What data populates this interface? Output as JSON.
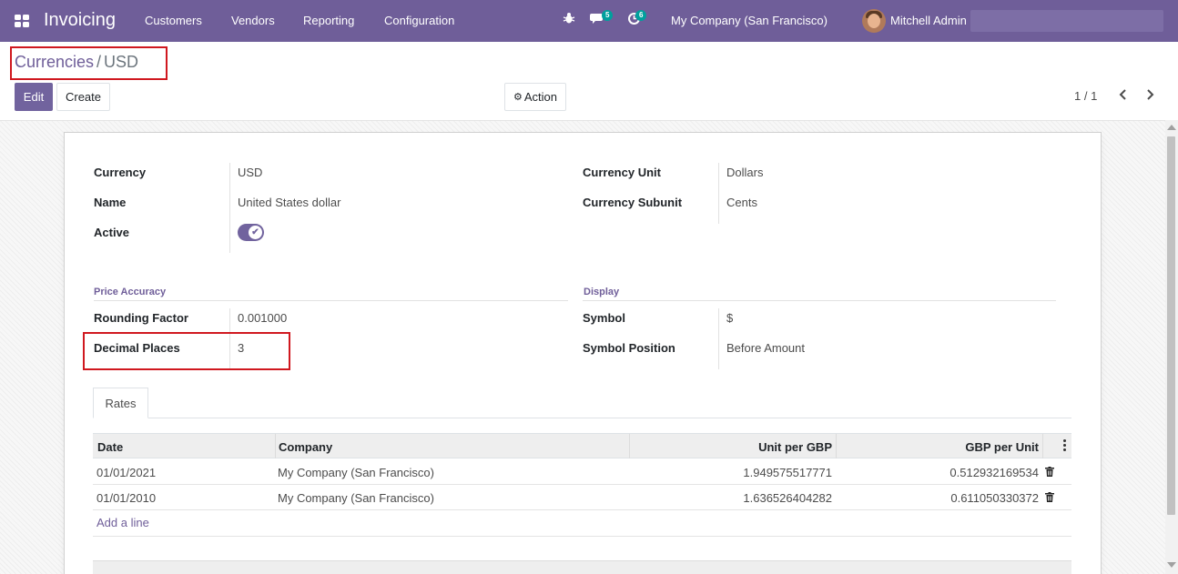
{
  "navbar": {
    "app_title": "Invoicing",
    "menu": [
      "Customers",
      "Vendors",
      "Reporting",
      "Configuration"
    ],
    "messages_badge": "5",
    "activities_badge": "6",
    "company": "My Company (San Francisco)",
    "user": "Mitchell Admin"
  },
  "control_panel": {
    "breadcrumb_parent": "Currencies",
    "breadcrumb_separator": "/",
    "breadcrumb_current": "USD",
    "edit_label": "Edit",
    "create_label": "Create",
    "action_label": "Action",
    "pager": "1 / 1"
  },
  "form": {
    "currency_label": "Currency",
    "currency_value": "USD",
    "name_label": "Name",
    "name_value": "United States dollar",
    "active_label": "Active",
    "active_value": true,
    "currency_unit_label": "Currency Unit",
    "currency_unit_value": "Dollars",
    "currency_subunit_label": "Currency Subunit",
    "currency_subunit_value": "Cents",
    "price_accuracy_title": "Price Accuracy",
    "rounding_factor_label": "Rounding Factor",
    "rounding_factor_value": "0.001000",
    "decimal_places_label": "Decimal Places",
    "decimal_places_value": "3",
    "display_title": "Display",
    "symbol_label": "Symbol",
    "symbol_value": "$",
    "symbol_position_label": "Symbol Position",
    "symbol_position_value": "Before Amount"
  },
  "tabs": [
    "Rates"
  ],
  "rates_table": {
    "headers": [
      "Date",
      "Company",
      "Unit per GBP",
      "GBP per Unit"
    ],
    "rows": [
      {
        "date": "01/01/2021",
        "company": "My Company (San Francisco)",
        "unit_per_gbp": "1.949575517771",
        "gbp_per_unit": "0.512932169534"
      },
      {
        "date": "01/01/2010",
        "company": "My Company (San Francisco)",
        "unit_per_gbp": "1.636526404282",
        "gbp_per_unit": "0.611050330372"
      }
    ],
    "add_line_label": "Add a line"
  },
  "colors": {
    "brand": "#6f5e99",
    "primary_button": "#71639e",
    "highlight": "#d0181f",
    "badge": "#00a09d"
  },
  "icons": [
    "apps-icon",
    "bug-icon",
    "chat-icon",
    "activity-icon",
    "gear-icon",
    "chevron-left-icon",
    "chevron-right-icon",
    "trash-icon",
    "kebab-icon",
    "check-icon"
  ]
}
